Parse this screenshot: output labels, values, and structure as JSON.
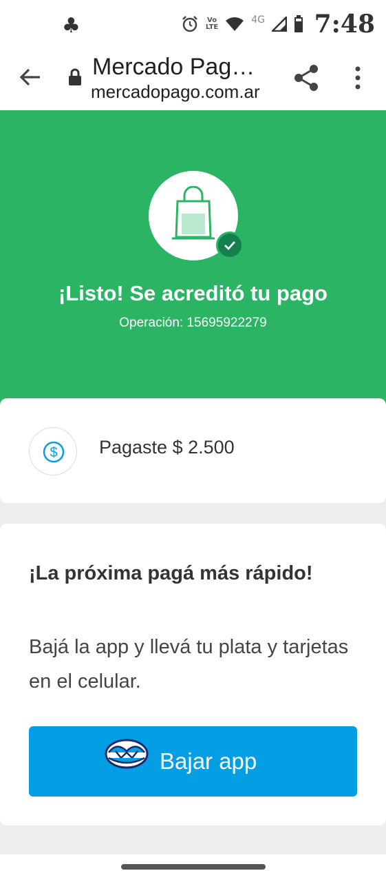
{
  "status_bar": {
    "left_icon": "club-icon",
    "time": "7:48",
    "volte_label_top": "Vo",
    "volte_label_bottom": "LTE",
    "network_label": "4G"
  },
  "browser": {
    "page_title": "Mercado Pag…",
    "url": "mercadopago.com.ar"
  },
  "hero": {
    "background": "#2ab463",
    "heading": "¡Listo! Se acreditó tu pago",
    "operation": "Operación: 15695922279"
  },
  "payment_card": {
    "amount_text": "Pagaste $ 2.500"
  },
  "promo_card": {
    "heading": "¡La próxima pagá más rápido!",
    "body": "Bajá la app y llevá tu plata y tarjetas en el celular.",
    "button_label": "Bajar app",
    "button_color": "#049ee5"
  }
}
